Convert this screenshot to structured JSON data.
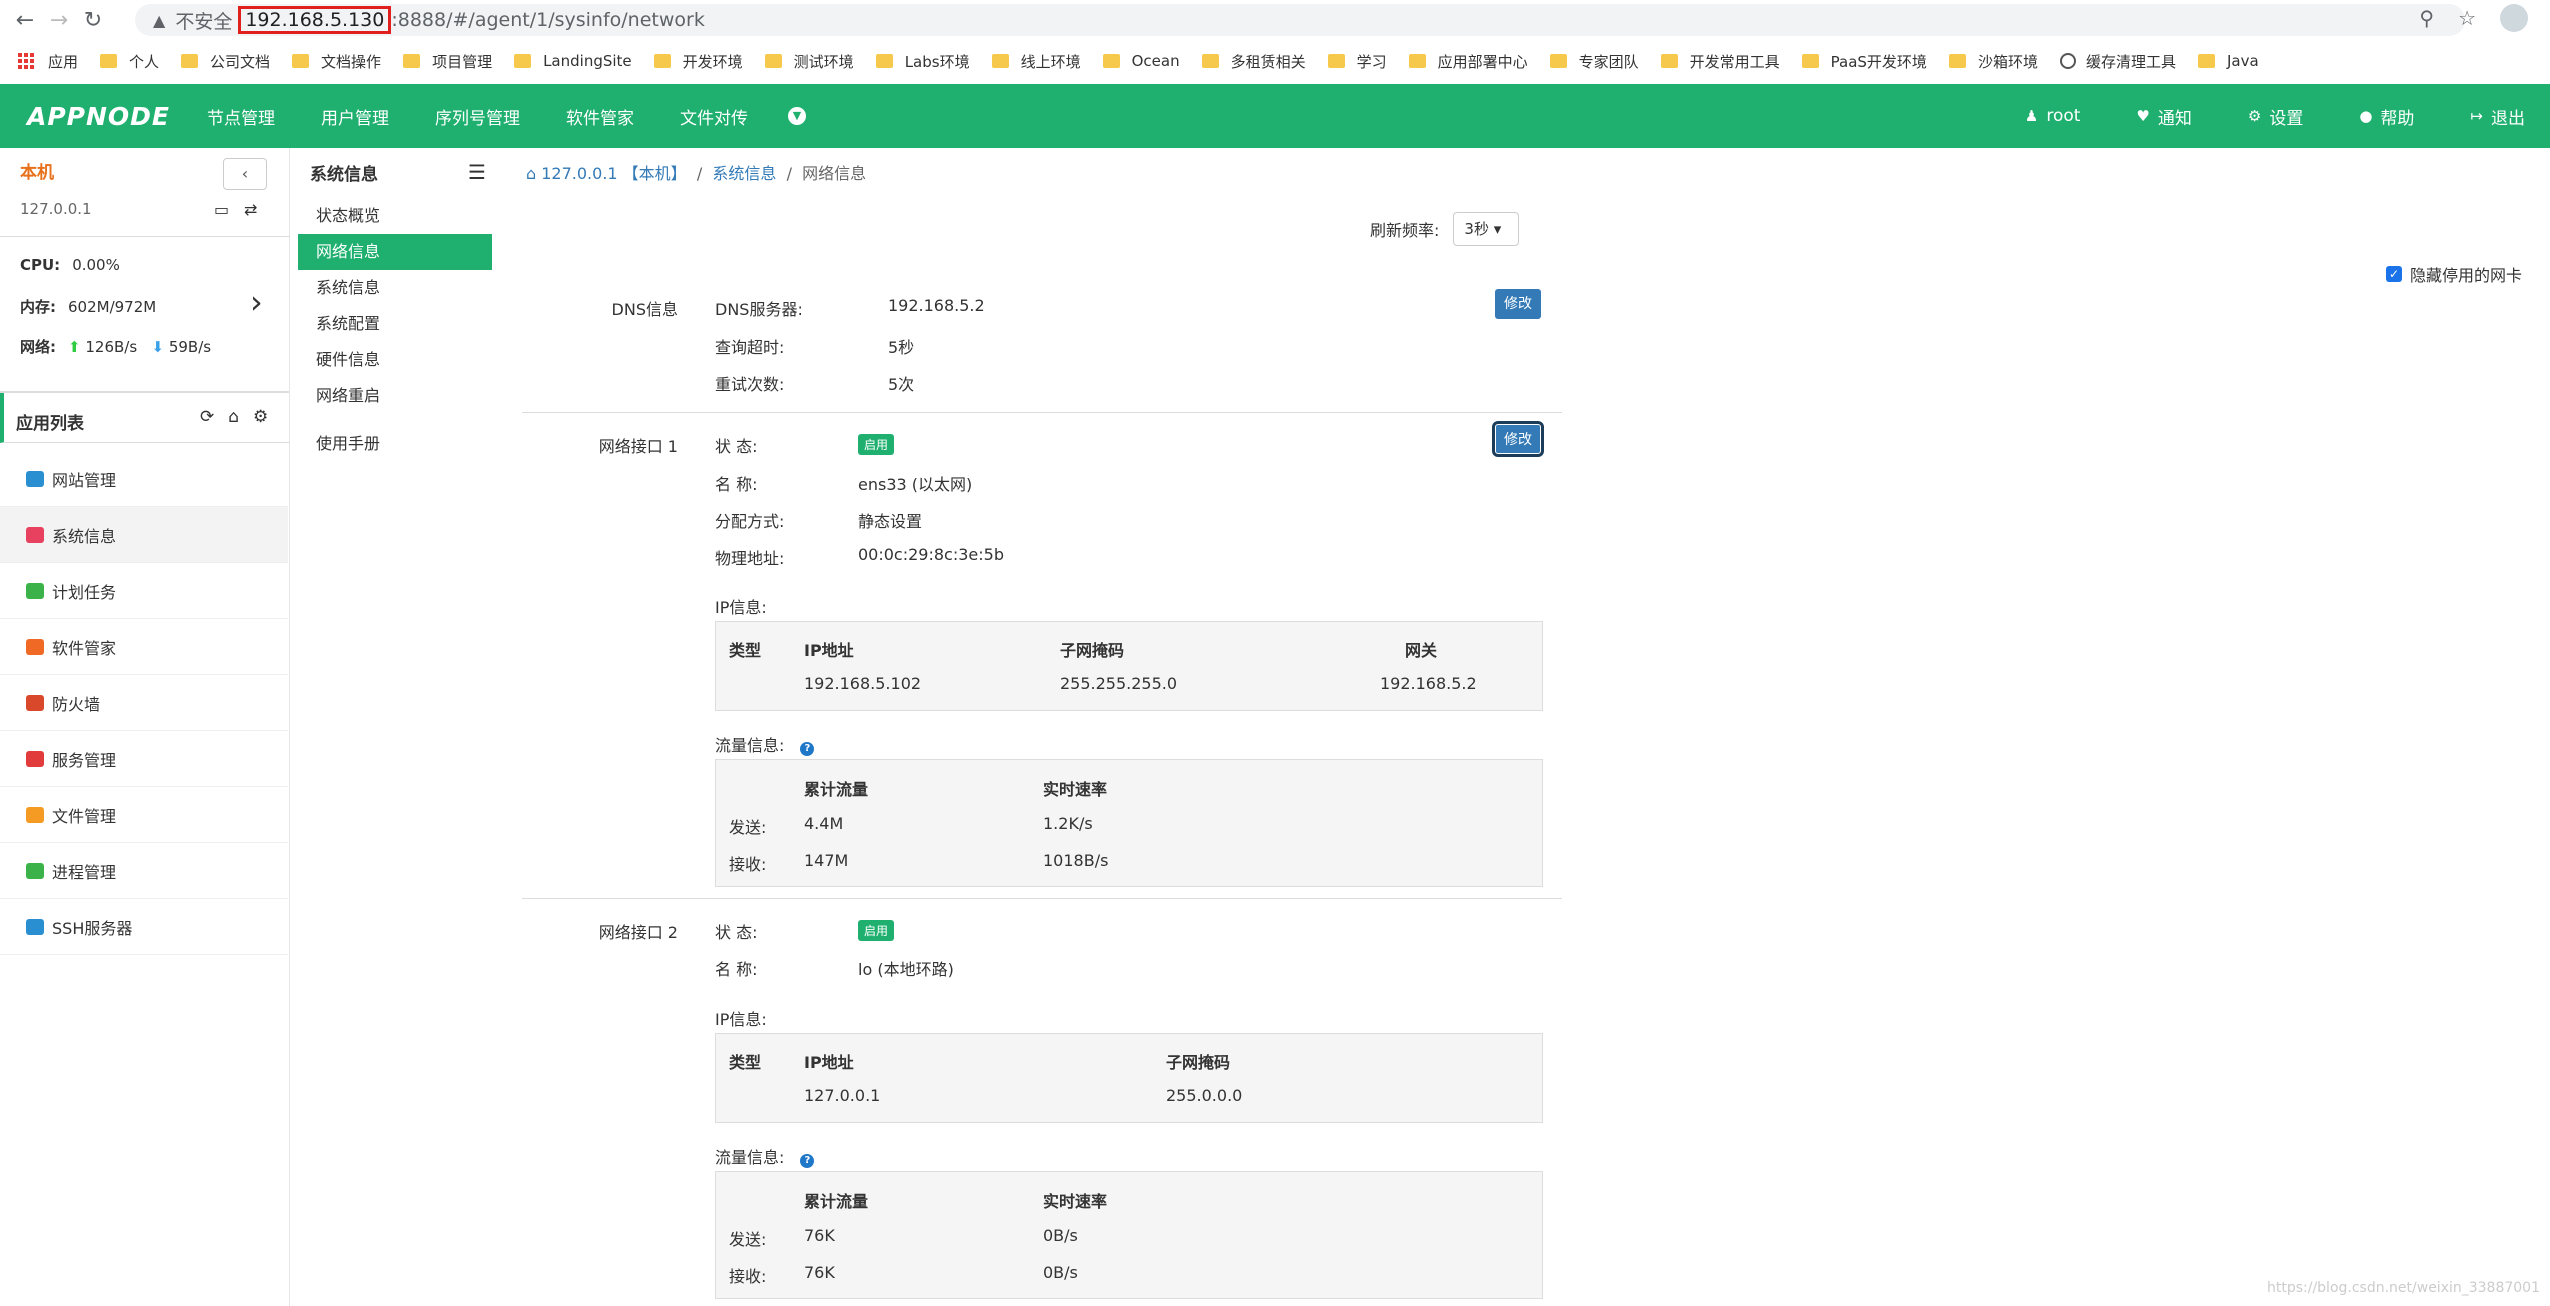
{
  "browser": {
    "insecure_label": "不安全",
    "url_host": "192.168.5.130",
    "url_rest": ":8888/#/agent/1/sysinfo/network",
    "bookmarks": [
      "应用",
      "个人",
      "公司文档",
      "文档操作",
      "项目管理",
      "LandingSite",
      "开发环境",
      "测试环境",
      "Labs环境",
      "线上环境",
      "Ocean",
      "多租赁相关",
      "学习",
      "应用部署中心",
      "专家团队",
      "开发常用工具",
      "PaaS开发环境",
      "沙箱环境",
      "缓存清理工具",
      "Java"
    ]
  },
  "header": {
    "logo": "APPNODE",
    "nav": [
      "节点管理",
      "用户管理",
      "序列号管理",
      "软件管家",
      "文件对传"
    ],
    "right": {
      "user": "root",
      "notify": "通知",
      "settings": "设置",
      "help": "帮助",
      "logout": "退出"
    }
  },
  "sidebar": {
    "host_title": "本机",
    "host_ip": "127.0.0.1",
    "cpu_label": "CPU:",
    "cpu_value": "0.00%",
    "mem_label": "内存:",
    "mem_value": "602M/972M",
    "net_label": "网络:",
    "net_up": "126B/s",
    "net_down": "59B/s",
    "applist_title": "应用列表",
    "menu": [
      {
        "label": "网站管理",
        "color": "#2a8fd1"
      },
      {
        "label": "系统信息",
        "color": "#e8405f"
      },
      {
        "label": "计划任务",
        "color": "#3cb34a"
      },
      {
        "label": "软件管家",
        "color": "#f06a26"
      },
      {
        "label": "防火墙",
        "color": "#d9482b"
      },
      {
        "label": "服务管理",
        "color": "#e23b3b"
      },
      {
        "label": "文件管理",
        "color": "#f59a23"
      },
      {
        "label": "进程管理",
        "color": "#3cb34a"
      },
      {
        "label": "SSH服务器",
        "color": "#2a8fd1"
      }
    ]
  },
  "subnav": {
    "title": "系统信息",
    "items": [
      "状态概览",
      "网络信息",
      "系统信息",
      "系统配置",
      "硬件信息",
      "网络重启",
      "使用手册"
    ]
  },
  "breadcrumb": {
    "host": "127.0.0.1 【本机】",
    "section": "系统信息",
    "page": "网络信息"
  },
  "refresh": {
    "label": "刷新频率:",
    "value": "3秒"
  },
  "hide_nic_label": "隐藏停用的网卡",
  "edit_label": "修改",
  "dns": {
    "section": "DNS信息",
    "server_label": "DNS服务器:",
    "server": "192.168.5.2",
    "timeout_label": "查询超时:",
    "timeout": "5秒",
    "retry_label": "重试次数:",
    "retry": "5次"
  },
  "nic1": {
    "section": "网络接口 1",
    "status_label": "状 态:",
    "status": "启用",
    "name_label": "名 称:",
    "name": "ens33 (以太网)",
    "assign_label": "分配方式:",
    "assign": "静态设置",
    "mac_label": "物理地址:",
    "mac": "00:0c:29:8c:3e:5b",
    "ip_title": "IP信息:",
    "ip_headers": [
      "类型",
      "IP地址",
      "子网掩码",
      "网关"
    ],
    "ip_row": [
      "",
      "192.168.5.102",
      "255.255.255.0",
      "192.168.5.2"
    ],
    "traffic_title": "流量信息:",
    "traffic_headers": [
      "累计流量",
      "实时速率"
    ],
    "send_label": "发送:",
    "send_total": "4.4M",
    "send_rate": "1.2K/s",
    "recv_label": "接收:",
    "recv_total": "147M",
    "recv_rate": "1018B/s"
  },
  "nic2": {
    "section": "网络接口 2",
    "status_label": "状 态:",
    "status": "启用",
    "name_label": "名 称:",
    "name": "lo (本地环路)",
    "ip_title": "IP信息:",
    "ip_headers": [
      "类型",
      "IP地址",
      "子网掩码"
    ],
    "ip_row": [
      "",
      "127.0.0.1",
      "255.0.0.0"
    ],
    "traffic_title": "流量信息:",
    "traffic_headers": [
      "累计流量",
      "实时速率"
    ],
    "send_label": "发送:",
    "send_total": "76K",
    "send_rate": "0B/s",
    "recv_label": "接收:",
    "recv_total": "76K",
    "recv_rate": "0B/s"
  },
  "watermark": "https://blog.csdn.net/weixin_33887001"
}
